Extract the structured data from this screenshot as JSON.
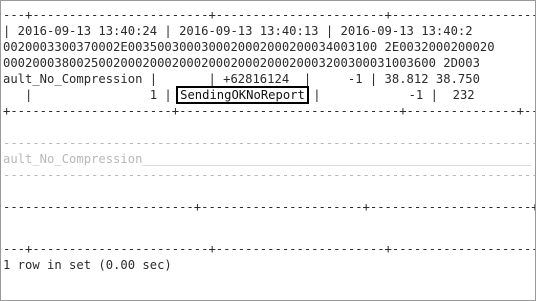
{
  "terminal": {
    "border_top": "---+------------------------+-----------------------+---------------------+",
    "timestamps_row": "| 2016-09-13 13:40:24 | 2016-09-13 13:40:13 | 2016-09-13 13:40:2",
    "hex_row_1": "0020003300370002E0035003000300020002000200034003100 2E0032000200020",
    "hex_row_2": "00020003800250020002000200020002000200020003200300031003600 2D003",
    "compression_row": "ault_No_Compression |       | +62816124  |     -1 | 38.812 38.750",
    "status_prefix": "   |                1 | ",
    "status_highlight": "SendingOKNoReport",
    "status_suffix": " |            -1 |  232",
    "border_mid": "+----------------------+------------------------------+---------------+----",
    "dashed_1": "--------------------------------------------------------------------------",
    "faded_row": "ault_No_Compression_____________________________________________________",
    "dashed_2": "--------------------------------------------------------------------------",
    "border_bottom_1": "--------------------------+----------------------+----------------------+---",
    "border_bottom_2": "---+------------------------+-----------------------+---------------------+",
    "result": "1 row in set (0.00 sec)"
  },
  "colors": {
    "text": "#2b2b2b",
    "faint": "#b8b8b8",
    "highlight_border": "#000000"
  }
}
